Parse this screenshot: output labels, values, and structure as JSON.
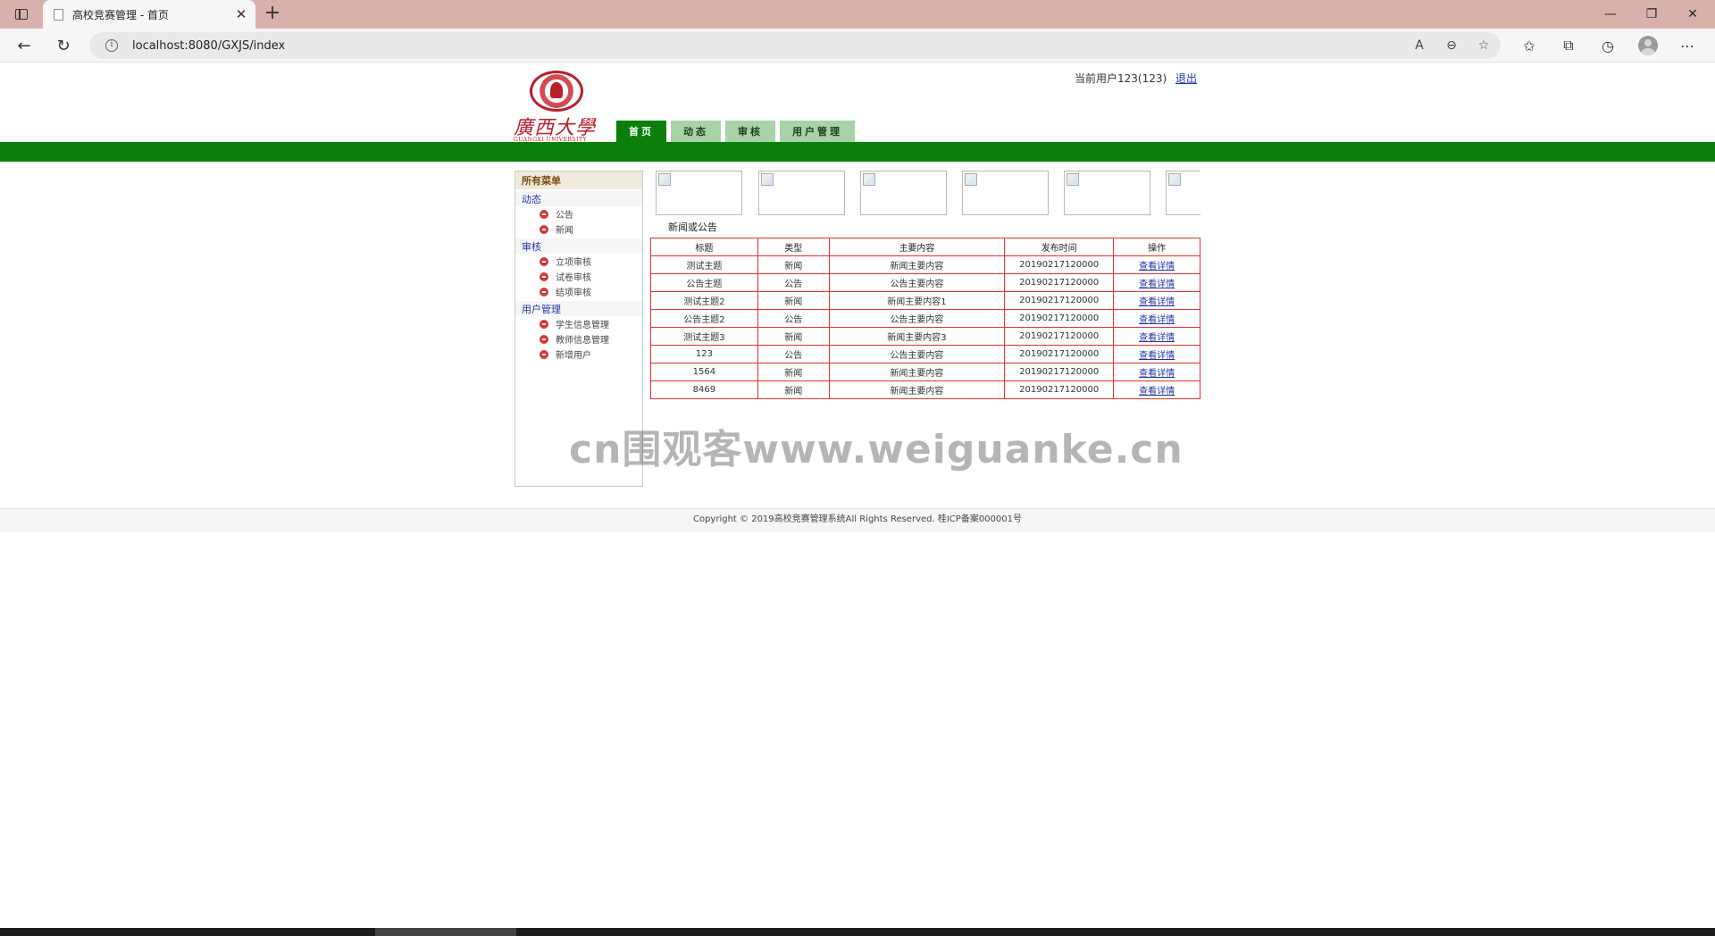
{
  "browser": {
    "tab_title": "高校竞赛管理 - 首页",
    "tab_close": "✕",
    "new_tab": "+",
    "url": "localhost:8080/GXJS/index",
    "icons": [
      "sidebar-toggle-icon",
      "page-icon",
      "back-arrow-icon",
      "refresh-icon",
      "info-icon",
      "read-aloud-icon",
      "zoom-out-icon",
      "add-favorite-icon",
      "favorites-icon",
      "collections-icon",
      "history-icon",
      "profile-icon",
      "more-icon"
    ]
  },
  "header": {
    "logo_cn": "廣西大學",
    "logo_en": "GUANGXI UNIVERSITY",
    "current_user": "当前用户123(123)",
    "logout": "退出"
  },
  "nav": {
    "tabs": [
      {
        "label": "首页",
        "active": true
      },
      {
        "label": "动态",
        "active": false
      },
      {
        "label": "审核",
        "active": false
      },
      {
        "label": "用户管理",
        "active": false
      }
    ]
  },
  "sidebar": {
    "title": "所有菜单",
    "groups": [
      {
        "label": "动态",
        "items": [
          "公告",
          "新闻"
        ]
      },
      {
        "label": "审核",
        "items": [
          "立项审核",
          "试卷审核",
          "结项审核"
        ]
      },
      {
        "label": "用户管理",
        "items": [
          "学生信息管理",
          "教师信息管理",
          "新增用户"
        ]
      }
    ]
  },
  "news": {
    "section_title": "新闻或公告",
    "columns": [
      "标题",
      "类型",
      "主要内容",
      "发布时间",
      "操作"
    ],
    "rows": [
      [
        "测试主题",
        "新闻",
        "新闻主要内容",
        "20190217120000",
        "查看详情"
      ],
      [
        "公告主题",
        "公告",
        "公告主要内容",
        "20190217120000",
        "查看详情"
      ],
      [
        "测试主题2",
        "新闻",
        "新闻主要内容1",
        "20190217120000",
        "查看详情"
      ],
      [
        "公告主题2",
        "公告",
        "公告主要内容",
        "20190217120000",
        "查看详情"
      ],
      [
        "测试主题3",
        "新闻",
        "新闻主要内容3",
        "20190217120000",
        "查看详情"
      ],
      [
        "123",
        "公告",
        "公告主要内容",
        "20190217120000",
        "查看详情"
      ],
      [
        "1564",
        "新闻",
        "新闻主要内容",
        "20190217120000",
        "查看详情"
      ],
      [
        "8469",
        "新闻",
        "新闻主要内容",
        "20190217120000",
        "查看详情"
      ]
    ]
  },
  "watermark": "cn围观客www.weiguanke.cn",
  "footer": "Copyright © 2019高校竞赛管理系统All Rights Reserved. 桂ICP备案000001号",
  "colors": {
    "primary_green": "#0a7f0a",
    "tab_green": "#a8d2a8",
    "table_border": "#e53333",
    "link_blue": "#2234a8",
    "tabbar": "#d9b1ab"
  }
}
